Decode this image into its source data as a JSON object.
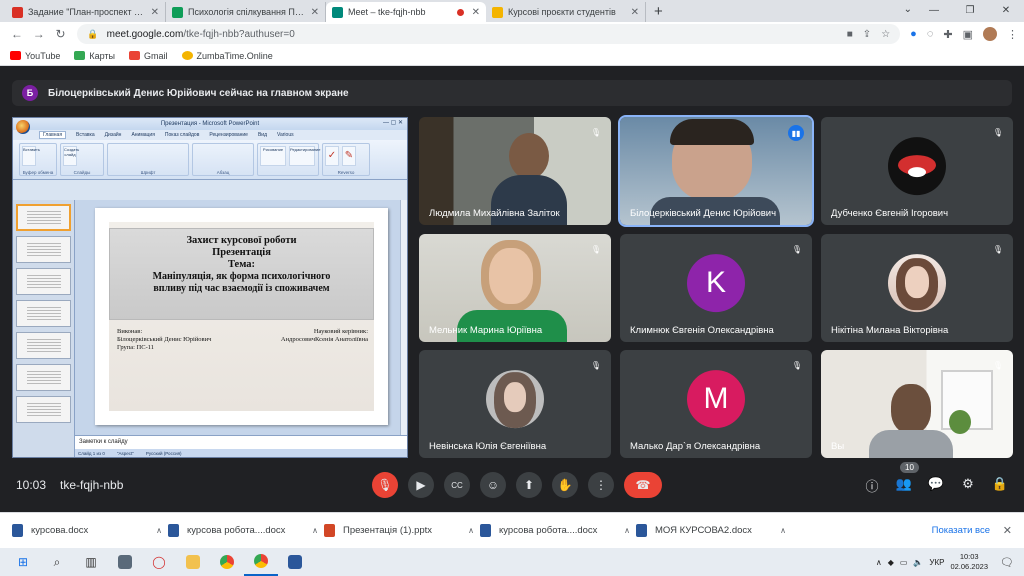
{
  "browser": {
    "tabs": [
      {
        "title": "Задание \"План-проспект до кур",
        "color": "#d93025",
        "active": false
      },
      {
        "title": "Психологія спілкування ПС-11",
        "color": "#0f9d58",
        "active": false
      },
      {
        "title": "Meet – tke-fqjh-nbb",
        "color": "#00897b",
        "active": true
      },
      {
        "title": "Курсові проєкти студентів",
        "color": "#f4b400",
        "active": false
      }
    ],
    "url_host": "meet.google.com",
    "url_path": "/tke-fqjh-nbb?authuser=0",
    "bookmarks": [
      {
        "label": "YouTube",
        "color": "#ff0000"
      },
      {
        "label": "Карты",
        "color": "#34a853"
      },
      {
        "label": "Gmail",
        "color": "#ea4335"
      },
      {
        "label": "ZumbaTime.Online",
        "color": "#f4b400"
      }
    ]
  },
  "meet": {
    "banner_initial": "Б",
    "banner_text": "Білоцерківський Денис Юрійович сейчас на главном экране",
    "time": "10:03",
    "code": "tke-fqjh-nbb",
    "participant_count": "10"
  },
  "powerpoint": {
    "window_title": "Презентация - Microsoft PowerPoint",
    "menu": [
      "Главная",
      "Вставка",
      "Дизайн",
      "Анимация",
      "Показ слайдов",
      "Рецензирование",
      "Вид",
      "Various"
    ],
    "groups": [
      "Буфер обмена",
      "Слайды",
      "Шрифт",
      "Абзац",
      "",
      "Reverso"
    ],
    "buttons": [
      "Вставить",
      "Создать слайд",
      "Рисование",
      "Редактирование",
      "Correct",
      "Rephraser"
    ],
    "notes_placeholder": "Заметки к слайду",
    "status": [
      "Слайд 1 из 0",
      "\"Aspect\"",
      "Русский (Россия)"
    ],
    "slide": {
      "line1": "Захист курсової роботи",
      "line2": "Презентація",
      "line3": "Тема:",
      "line4": "Маніпуляція, як форма психологічного",
      "line5": "впливу під час взаємодії із споживачем",
      "left1": "Виконав:",
      "left2": "Білоцерківський Денис Юрійович",
      "left3": "Група: ПС-11",
      "right1": "Науковий керівник:",
      "right2": "АндросовичКсенія Анатоліївна"
    }
  },
  "participants": [
    {
      "name": "Людмила Михайлівна Заліток",
      "type": "video",
      "muted": true
    },
    {
      "name": "Білоцерківський Денис Юрійович",
      "type": "video",
      "speaking": true
    },
    {
      "name": "Дубченко Євгеній Ігорович",
      "type": "logo",
      "muted": true
    },
    {
      "name": "Мельник Марина Юріївна",
      "type": "video",
      "muted": true
    },
    {
      "name": "Климнюк Євгенія Олександрівна",
      "type": "letter",
      "letter": "K",
      "color": "#8e24aa",
      "muted": true
    },
    {
      "name": "Нікітіна Милана Вікторівна",
      "type": "photo",
      "muted": true
    },
    {
      "name": "Невінська Юлія Євгеніївна",
      "type": "photo",
      "muted": true
    },
    {
      "name": "Малько Дар`я Олександрівна",
      "type": "letter",
      "letter": "M",
      "color": "#d81b60",
      "muted": true
    },
    {
      "name": "Вы",
      "type": "video",
      "muted": true
    }
  ],
  "downloads": [
    {
      "name": "курсова.docx",
      "color": "#2b579a"
    },
    {
      "name": "курсова робота....docx",
      "color": "#2b579a"
    },
    {
      "name": "Презентація (1).pptx",
      "color": "#d24726"
    },
    {
      "name": "курсова робота....docx",
      "color": "#2b579a"
    },
    {
      "name": "МОЯ КУРСОВА2.docx",
      "color": "#2b579a"
    }
  ],
  "shelf": {
    "show_all": "Показати все"
  },
  "taskbar": {
    "lang": "УКР",
    "time": "10:03",
    "date": "02.06.2023"
  }
}
